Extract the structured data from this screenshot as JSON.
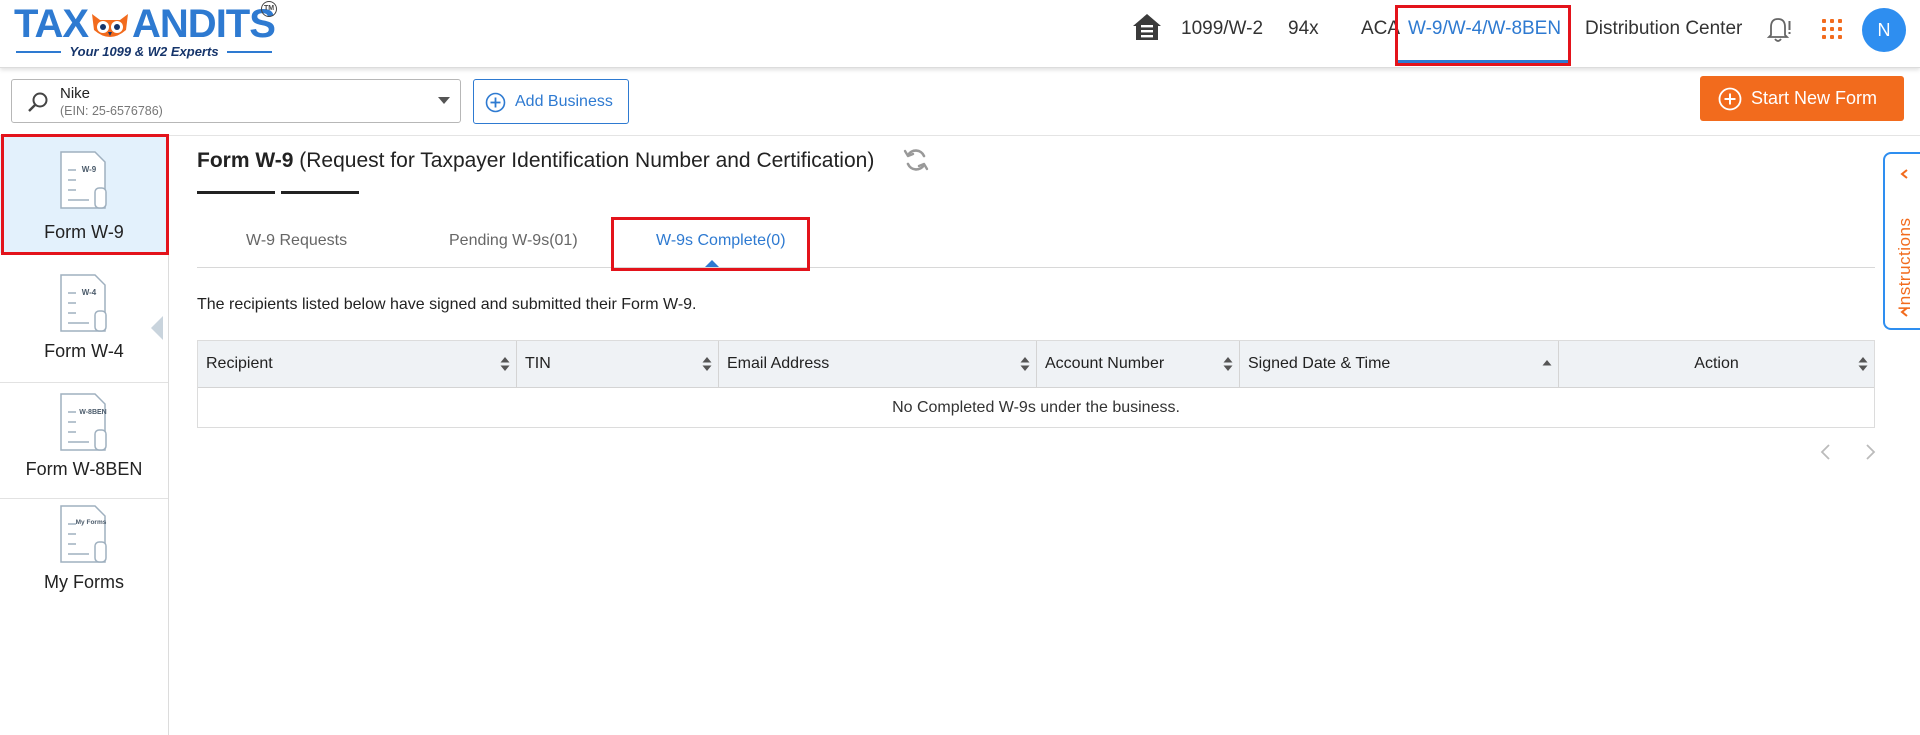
{
  "brand": {
    "logo_text_left": "TAX",
    "logo_text_right": "ANDITS",
    "logo_tm": "TM",
    "tagline": "Your 1099 & W2 Experts",
    "logo_blue": "#2e7ad1",
    "logo_orange": "#f26b1d"
  },
  "nav": {
    "items": [
      {
        "label": "1099/W-2"
      },
      {
        "label": "94x"
      },
      {
        "label": "ACA"
      },
      {
        "label": "W-9/W-4/W-8BEN"
      },
      {
        "label": "Distribution Center"
      }
    ],
    "active_index": 3,
    "home_icon": "home-icon",
    "bell_icon": "bell-icon",
    "apps_icon": "apps-grid-icon",
    "avatar_initial": "N"
  },
  "business": {
    "name": "Nike",
    "ein": "(EIN: 25-6576786)",
    "add_label": "Add Business"
  },
  "start_button": {
    "label": "Start New Form"
  },
  "sidebar": {
    "items": [
      {
        "label": "Form W-9",
        "icon_tag": "W-9"
      },
      {
        "label": "Form W-4",
        "icon_tag": "W-4"
      },
      {
        "label": "Form W-8BEN",
        "icon_tag": "W-8BEN"
      },
      {
        "label": "My Forms",
        "icon_tag": "My Forms"
      }
    ],
    "active_index": 0
  },
  "page": {
    "title_bold": "Form W-9",
    "title_rest": " (Request for Taxpayer Identification Number and Certification)",
    "tabs": [
      {
        "label": "W-9 Requests"
      },
      {
        "label": "Pending W-9s(01)"
      },
      {
        "label": "W-9s Complete(0)"
      }
    ],
    "active_tab": 2,
    "description": "The recipients listed below have signed and submitted their Form W-9."
  },
  "table": {
    "columns": [
      {
        "label": "Recipient"
      },
      {
        "label": "TIN"
      },
      {
        "label": "Email Address"
      },
      {
        "label": "Account Number"
      },
      {
        "label": "Signed Date & Time"
      },
      {
        "label": "Action"
      }
    ],
    "empty_message": "No Completed W-9s under the business."
  },
  "instructions": {
    "label": "Instructions"
  },
  "colors": {
    "accent_blue": "#2e7ad1",
    "accent_orange": "#f26b1d",
    "highlight_red": "#e3131b",
    "sidebar_active_bg": "#e3f1fc",
    "table_header_bg": "#eff2f5"
  }
}
